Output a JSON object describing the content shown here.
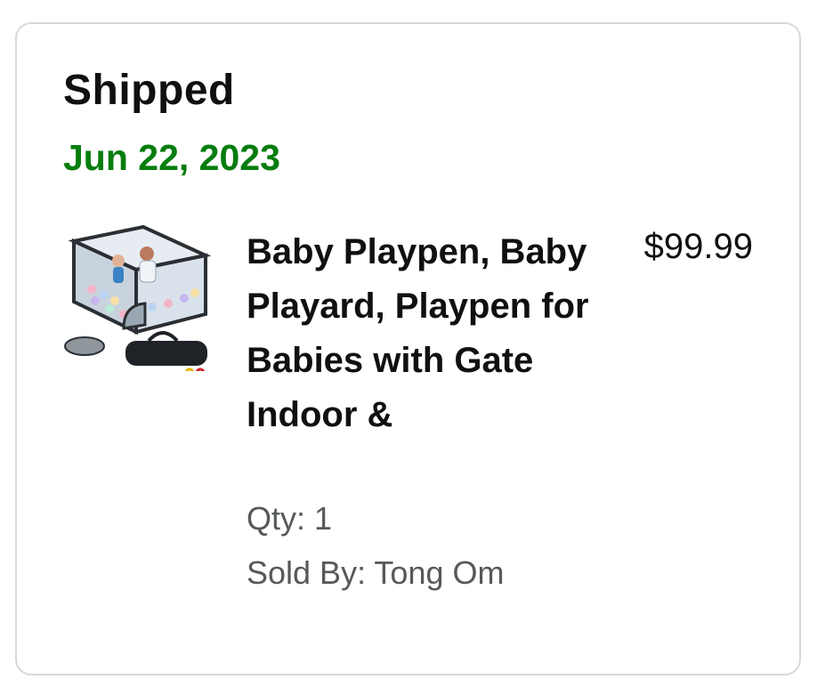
{
  "order": {
    "status": "Shipped",
    "date": "Jun 22, 2023",
    "status_color": "#067d0e"
  },
  "item": {
    "title": "Baby Playpen, Baby Playard, Playpen for Babies with Gate Indoor &",
    "price": "$99.99",
    "qty": "Qty: 1",
    "sold_by": "Sold By: Tong Om",
    "image_icon": "product-image-playpen"
  }
}
